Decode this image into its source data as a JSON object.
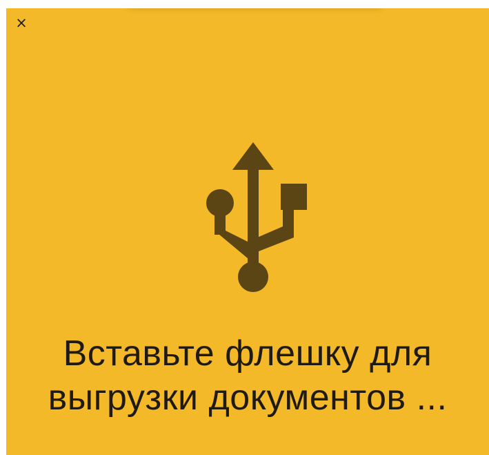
{
  "dialog": {
    "close_label": "×",
    "icon": "usb-icon",
    "message_line1": "Вставьте флешку для",
    "message_line2": "выгрузки документов ..."
  },
  "colors": {
    "background": "#f4b928",
    "icon": "#5c4514",
    "text": "#1f1a12"
  }
}
